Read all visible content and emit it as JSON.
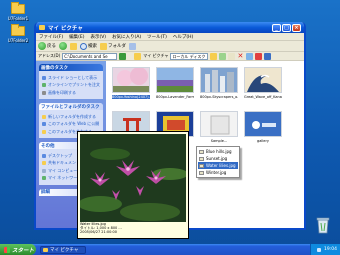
{
  "desktop": {
    "icons": [
      {
        "label": "U7Folder1"
      },
      {
        "label": "U7Folder2"
      }
    ]
  },
  "window": {
    "title": "マイ ピクチャ",
    "menubar": [
      "ファイル(F)",
      "編集(E)",
      "表示(V)",
      "お気に入り(A)",
      "ツール(T)",
      "ヘルプ(H)"
    ],
    "toolbar": {
      "back_label": "戻る",
      "search_label": "検索",
      "folders_label": "フォルダ"
    },
    "address": {
      "label": "アドレス(D)",
      "value": "C:\\Documents and Se"
    },
    "tab": {
      "label": "マイ ピクチャ",
      "location": "ローカル ディスク (C:)"
    }
  },
  "left_pane": {
    "image_tasks": {
      "title": "画像のタスク",
      "links": [
        "スライド ショーとして表示",
        "オンラインでプリントを注文",
        "画像を印刷する"
      ]
    },
    "file_tasks": {
      "title": "ファイルとフォルダのタスク",
      "links": [
        "新しいフォルダを作成する",
        "このフォルダを Web に公開",
        "このフォルダを共有する"
      ]
    },
    "other_places": {
      "title": "その他",
      "links": [
        "デスクトップ",
        "共有ドキュメント",
        "マイ コンピュータ",
        "マイ ネットワーク"
      ]
    },
    "details": {
      "title": "詳細"
    }
  },
  "thumbnails": [
    {
      "caption": "800px-Yoshino(2407)..."
    },
    {
      "caption": "800px-Lavender_Farm..."
    },
    {
      "caption": "800px-Skyscrapers_o..."
    },
    {
      "caption": "Great_Wave_off_Kanag..."
    },
    {
      "caption": "800px-Itsukushima..."
    },
    {
      "caption": "800px-Blue..."
    },
    {
      "caption": "Sample..."
    },
    {
      "caption": "gallery"
    }
  ],
  "tooltip": {
    "lines": [
      "Water lilies.jpg",
      "タイトル: 1,000 x 800 ...",
      "2005/06/27 21:00:00"
    ]
  },
  "menu": {
    "items": [
      {
        "label": "Blue hills.jpg",
        "active": false
      },
      {
        "label": "Sunset.jpg",
        "active": false
      },
      {
        "label": "Water lilies.jpg",
        "active": true
      },
      {
        "label": "Winter.jpg",
        "active": false
      }
    ]
  },
  "taskbar": {
    "start_label": "スタート",
    "task_label": "マイ ピクチャ",
    "clock": "19:04"
  },
  "colors": {
    "desktop": "#1a72c8",
    "titlebar": "#0a5ad8",
    "selection": "#316ac5",
    "tooltip_bg": "#ffffe1"
  }
}
